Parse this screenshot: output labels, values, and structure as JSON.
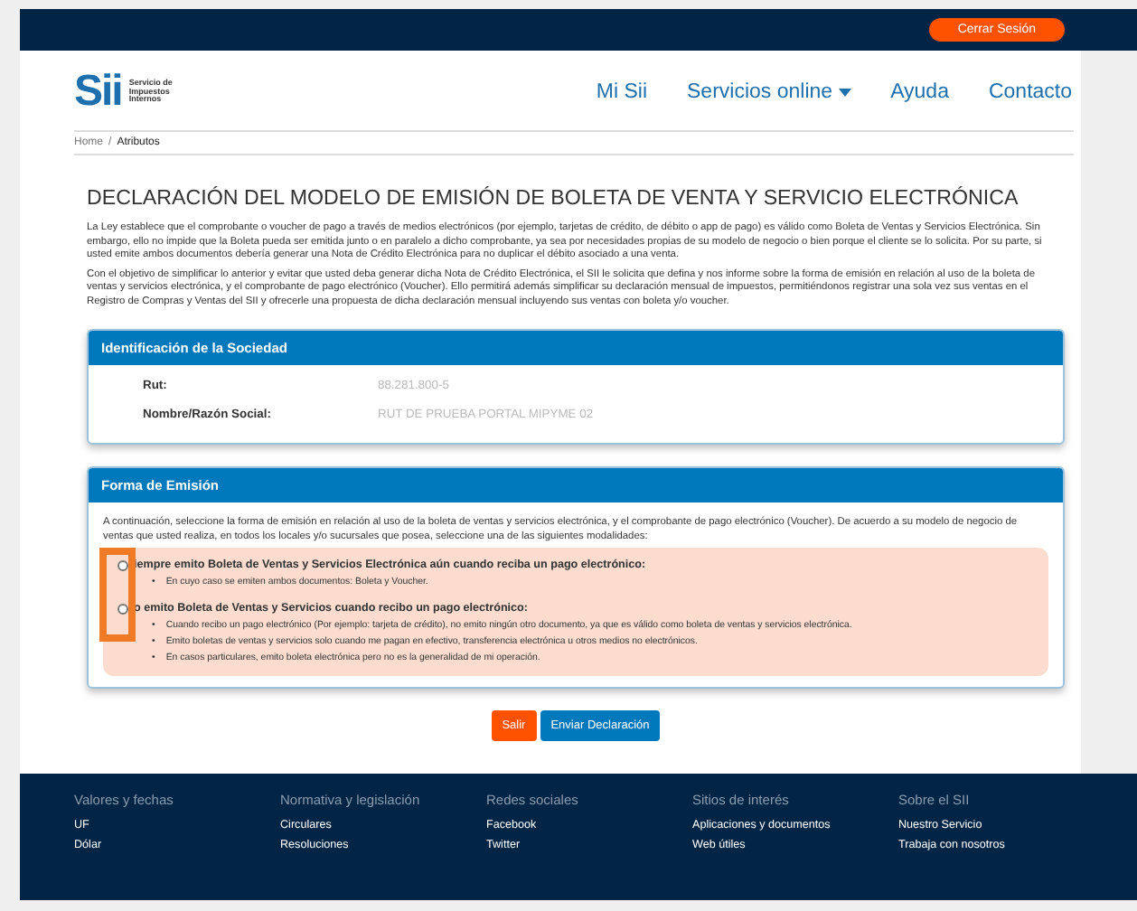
{
  "top_bar": {
    "logout_button": "Cerrar Sesión"
  },
  "header": {
    "logo": {
      "mark": "Sii",
      "text": "Servicio de Impuestos Internos"
    },
    "nav": [
      {
        "label": "Mi Sii",
        "dropdown": false
      },
      {
        "label": "Servicios online",
        "dropdown": true
      },
      {
        "label": "Ayuda",
        "dropdown": false
      },
      {
        "label": "Contacto",
        "dropdown": false
      }
    ]
  },
  "breadcrumb": {
    "separator": "/",
    "items": [
      "Home",
      "Atributos"
    ]
  },
  "title": "DECLARACIÓN DEL MODELO DE EMISIÓN DE BOLETA DE VENTA Y SERVICIO ELECTRÓNICA",
  "paragraphs": [
    "La Ley establece que el comprobante o voucher de pago a través de medios electrónicos (por ejemplo, tarjetas de crédito, de débito o app de pago) es válido como Boleta de Ventas y Servicios Electrónica. Sin embargo, ello no impide que la Boleta pueda ser emitida junto o en paralelo a dicho comprobante, ya sea por necesidades propias de su modelo de negocio o bien porque el cliente se lo solicita. Por su parte, si usted emite ambos documentos debería generar una Nota de Crédito Electrónica para no duplicar el débito asociado a una venta.",
    "Con el objetivo de simplificar lo anterior y evitar que usted deba generar dicha Nota de Crédito Electrónica, el SII le solicita que defina y nos informe sobre la forma de emisión en relación al uso de la boleta de ventas y servicios electrónica, y el comprobante de pago electrónico (Voucher). Ello permitirá además simplificar su declaración mensual de impuestos, permitiéndonos registrar una sola vez sus ventas en el Registro de Compras y Ventas del SII y ofrecerle una propuesta de dicha declaración mensual incluyendo sus ventas con boleta y/o voucher."
  ],
  "company_panel": {
    "heading": "Identificación de la Sociedad",
    "fields": [
      {
        "label": "Rut:",
        "value": "88.281.800-5"
      },
      {
        "label": "Nombre/Razón Social:",
        "value": "RUT DE PRUEBA PORTAL MIPYME 02"
      }
    ]
  },
  "emission_panel": {
    "heading": "Forma de Emisión",
    "intro": "A continuación, seleccione la forma de emisión en relación al uso de la boleta de ventas y servicios electrónica, y el comprobante de pago electrónico (Voucher). De acuerdo a su modelo de negocio de ventas que usted realiza, en todos los locales y/o sucursales que posea, seleccione una de las siguientes modalidades:",
    "bullet_marker": "•",
    "options": [
      {
        "label": "iempre emito Boleta de Ventas y Servicios Electrónica aún cuando reciba un pago electrónico:",
        "selected": false,
        "bullets": [
          "En cuyo caso se emiten ambos documentos: Boleta y Voucher."
        ]
      },
      {
        "label": "o emito Boleta de Ventas y Servicios cuando recibo un pago electrónico:",
        "selected": false,
        "bullets": [
          "Cuando recibo un pago electrónico (Por ejemplo: tarjeta de crédito), no emito ningún otro documento, ya que es válido como boleta de ventas y servicios electrónica.",
          "Emito boletas de ventas y servicios solo cuando me pagan en efectivo, transferencia electrónica u otros medios no electrónicos.",
          "En casos particulares, emito boleta electrónica pero no es la generalidad de mi operación."
        ]
      }
    ]
  },
  "actions": [
    {
      "label": "Salir",
      "kind": "secondary"
    },
    {
      "label": "Enviar Declaración",
      "kind": "primary"
    }
  ],
  "footer": [
    {
      "heading": "Valores y fechas",
      "links": [
        "UF",
        "Dólar"
      ]
    },
    {
      "heading": "Normativa y legislación",
      "links": [
        "Circulares",
        "Resoluciones"
      ]
    },
    {
      "heading": "Redes sociales",
      "links": [
        "Facebook",
        "Twitter"
      ]
    },
    {
      "heading": "Sitios de interés",
      "links": [
        "Aplicaciones y documentos",
        "Web útiles"
      ]
    },
    {
      "heading": "Sobre el SII",
      "links": [
        "Nuestro Servicio",
        "Trabaja con nosotros"
      ]
    }
  ]
}
